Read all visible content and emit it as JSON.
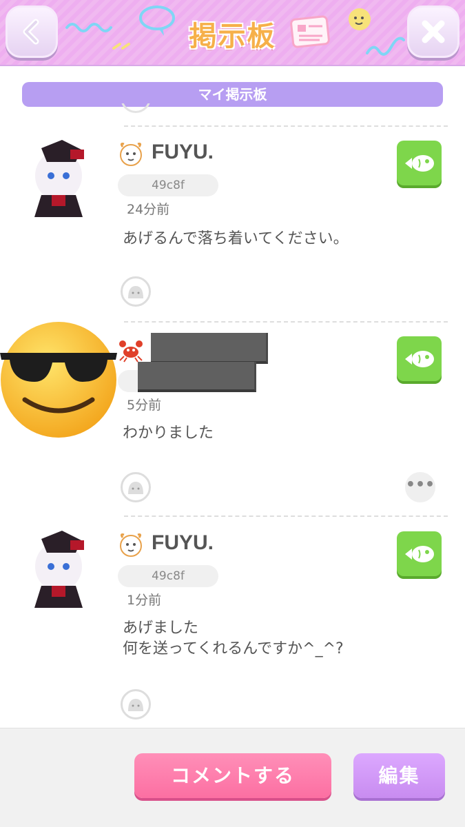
{
  "header": {
    "title": "掲示板",
    "back_icon": "chevron-left-icon",
    "close_icon": "close-icon"
  },
  "section_tab": {
    "label": "マイ掲示板"
  },
  "posts": [
    {
      "username": "FUYU.",
      "user_id": "49c8f",
      "time": "24分前",
      "message": "あげるんで落ち着いてください。",
      "has_more": false
    },
    {
      "username": "",
      "user_id": "",
      "time": "5分前",
      "message": "わかりました",
      "has_more": true,
      "more_label": "•••"
    },
    {
      "username": "FUYU.",
      "user_id": "49c8f",
      "time": "1分前",
      "message": "あげました\n何を送ってくれるんですか^_^?",
      "has_more": false
    }
  ],
  "footer": {
    "comment_label": "コメントする",
    "edit_label": "編集"
  },
  "colors": {
    "header_bg": "#f0b9f0",
    "tab_bg": "#b79ef2",
    "gift_green": "#7ed64b",
    "comment_pink": "#fc6fa2",
    "edit_purple": "#c88cf0"
  }
}
